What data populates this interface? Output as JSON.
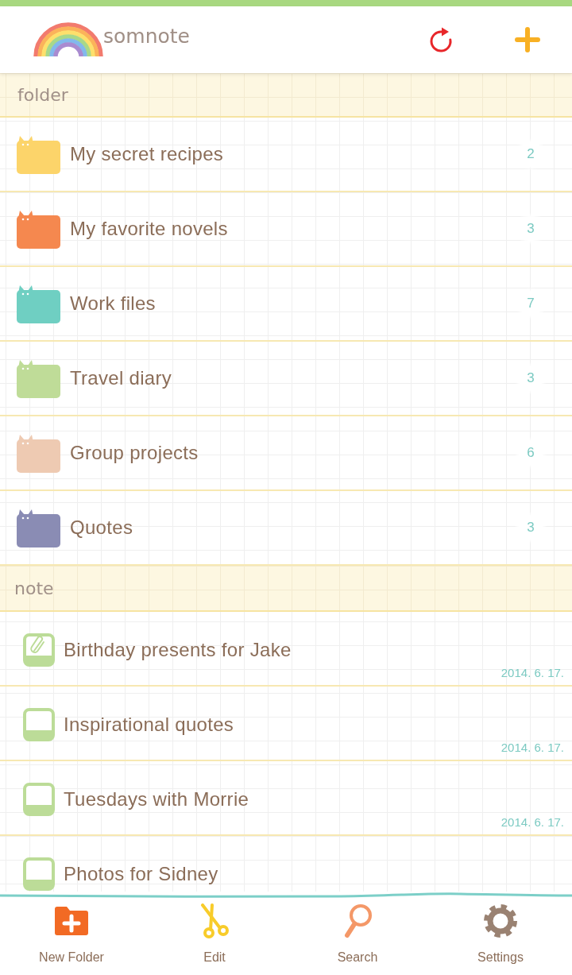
{
  "header": {
    "logo_text": "somnote"
  },
  "folder_section": {
    "label": "folder"
  },
  "folders": [
    {
      "name": "My secret recipes",
      "count": "2",
      "color": "#fcd46a"
    },
    {
      "name": "My favorite novels",
      "count": "3",
      "color": "#f5884f"
    },
    {
      "name": "Work files",
      "count": "7",
      "color": "#6fcfc2"
    },
    {
      "name": "Travel diary",
      "count": "3",
      "color": "#bfdc98"
    },
    {
      "name": "Group projects",
      "count": "6",
      "color": "#eecab2"
    },
    {
      "name": "Quotes",
      "count": "3",
      "color": "#8a8cb4"
    }
  ],
  "note_section": {
    "label": "note"
  },
  "notes": [
    {
      "title": "Birthday presents for Jake",
      "date": "2014. 6. 17.",
      "attachment": true
    },
    {
      "title": "Inspirational quotes",
      "date": "2014. 6. 17.",
      "attachment": false
    },
    {
      "title": "Tuesdays with Morrie",
      "date": "2014. 6. 17.",
      "attachment": false
    },
    {
      "title": "Photos for Sidney",
      "attachment": false
    }
  ],
  "toolbar": [
    {
      "kind": "new_folder",
      "label": "New Folder"
    },
    {
      "kind": "edit",
      "label": "Edit"
    },
    {
      "kind": "search",
      "label": "Search"
    },
    {
      "kind": "settings",
      "label": "Settings"
    }
  ]
}
